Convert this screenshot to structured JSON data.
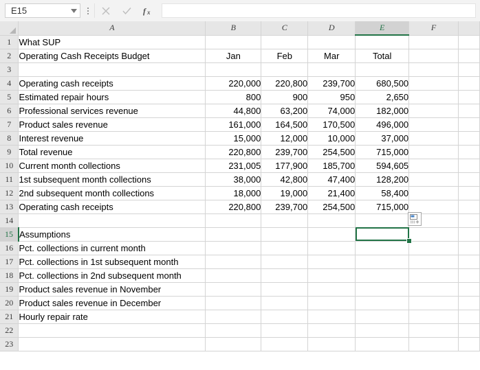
{
  "formula_bar": {
    "name_box_value": "E15",
    "name_box_dropdown_icon": "chevron-down-icon",
    "cancel_icon": "close-icon",
    "confirm_icon": "check-icon",
    "function_icon": "fx-icon",
    "formula_value": ""
  },
  "grid": {
    "columns": [
      "A",
      "B",
      "C",
      "D",
      "E",
      "F"
    ],
    "selected_column": "E",
    "selected_row": "15",
    "selected_cell": "E15",
    "row_numbers": [
      "1",
      "2",
      "3",
      "4",
      "5",
      "6",
      "7",
      "8",
      "9",
      "10",
      "11",
      "12",
      "13",
      "14",
      "15",
      "16",
      "17",
      "18",
      "19",
      "20",
      "21",
      "22",
      "23"
    ],
    "rows": [
      {
        "n": "1",
        "a": "What SUP",
        "b": "",
        "c": "",
        "d": "",
        "e": ""
      },
      {
        "n": "2",
        "a": "Operating Cash Receipts Budget",
        "b": "Jan",
        "c": "Feb",
        "d": "Mar",
        "e": "Total"
      },
      {
        "n": "3",
        "a": "",
        "b": "",
        "c": "",
        "d": "",
        "e": ""
      },
      {
        "n": "4",
        "a": "Operating cash receipts",
        "b": "220,000",
        "c": "220,800",
        "d": "239,700",
        "e": "680,500"
      },
      {
        "n": "5",
        "a": "Estimated repair hours",
        "b": "800",
        "c": "900",
        "d": "950",
        "e": "2,650"
      },
      {
        "n": "6",
        "a": "Professional services revenue",
        "b": "44,800",
        "c": "63,200",
        "d": "74,000",
        "e": "182,000"
      },
      {
        "n": "7",
        "a": "Product sales revenue",
        "b": "161,000",
        "c": "164,500",
        "d": "170,500",
        "e": "496,000"
      },
      {
        "n": "8",
        "a": "Interest revenue",
        "b": "15,000",
        "c": "12,000",
        "d": "10,000",
        "e": "37,000"
      },
      {
        "n": "9",
        "a": "Total revenue",
        "b": "220,800",
        "c": "239,700",
        "d": "254,500",
        "e": "715,000"
      },
      {
        "n": "10",
        "a": "Current month collections",
        "b": "231,005",
        "c": "177,900",
        "d": "185,700",
        "e": "594,605"
      },
      {
        "n": "11",
        "a": "1st subsequent month collections",
        "b": "38,000",
        "c": "42,800",
        "d": "47,400",
        "e": "128,200"
      },
      {
        "n": "12",
        "a": "2nd subsequent month collections",
        "b": "18,000",
        "c": "19,000",
        "d": "21,400",
        "e": "58,400"
      },
      {
        "n": "13",
        "a": "Operating cash receipts",
        "b": "220,800",
        "c": "239,700",
        "d": "254,500",
        "e": "715,000"
      },
      {
        "n": "14",
        "a": "",
        "b": "",
        "c": "",
        "d": "",
        "e": ""
      },
      {
        "n": "15",
        "a": "Assumptions",
        "b": "",
        "c": "",
        "d": "",
        "e": ""
      },
      {
        "n": "16",
        "a": "Pct. collections in current month",
        "b": "",
        "c": "",
        "d": "",
        "e": ""
      },
      {
        "n": "17",
        "a": "Pct. collections in 1st subsequent month",
        "b": "",
        "c": "",
        "d": "",
        "e": ""
      },
      {
        "n": "18",
        "a": "Pct. collections in 2nd subsequent month",
        "b": "",
        "c": "",
        "d": "",
        "e": ""
      },
      {
        "n": "19",
        "a": "Product sales revenue in November",
        "b": "",
        "c": "",
        "d": "",
        "e": ""
      },
      {
        "n": "20",
        "a": "Product sales revenue in December",
        "b": "",
        "c": "",
        "d": "",
        "e": ""
      },
      {
        "n": "21",
        "a": "Hourly repair rate",
        "b": "",
        "c": "",
        "d": "",
        "e": ""
      },
      {
        "n": "22",
        "a": "",
        "b": "",
        "c": "",
        "d": "",
        "e": ""
      },
      {
        "n": "23",
        "a": "",
        "b": "",
        "c": "",
        "d": "",
        "e": ""
      }
    ]
  },
  "overlays": {
    "quick_analysis_icon": "quick-analysis-icon",
    "fill_handle": "fill-handle"
  },
  "colors": {
    "accent_green": "#217346",
    "header_gray": "#e6e6e6",
    "header_selected_gray": "#d2d2d2",
    "gridline": "#d4d4d4"
  }
}
